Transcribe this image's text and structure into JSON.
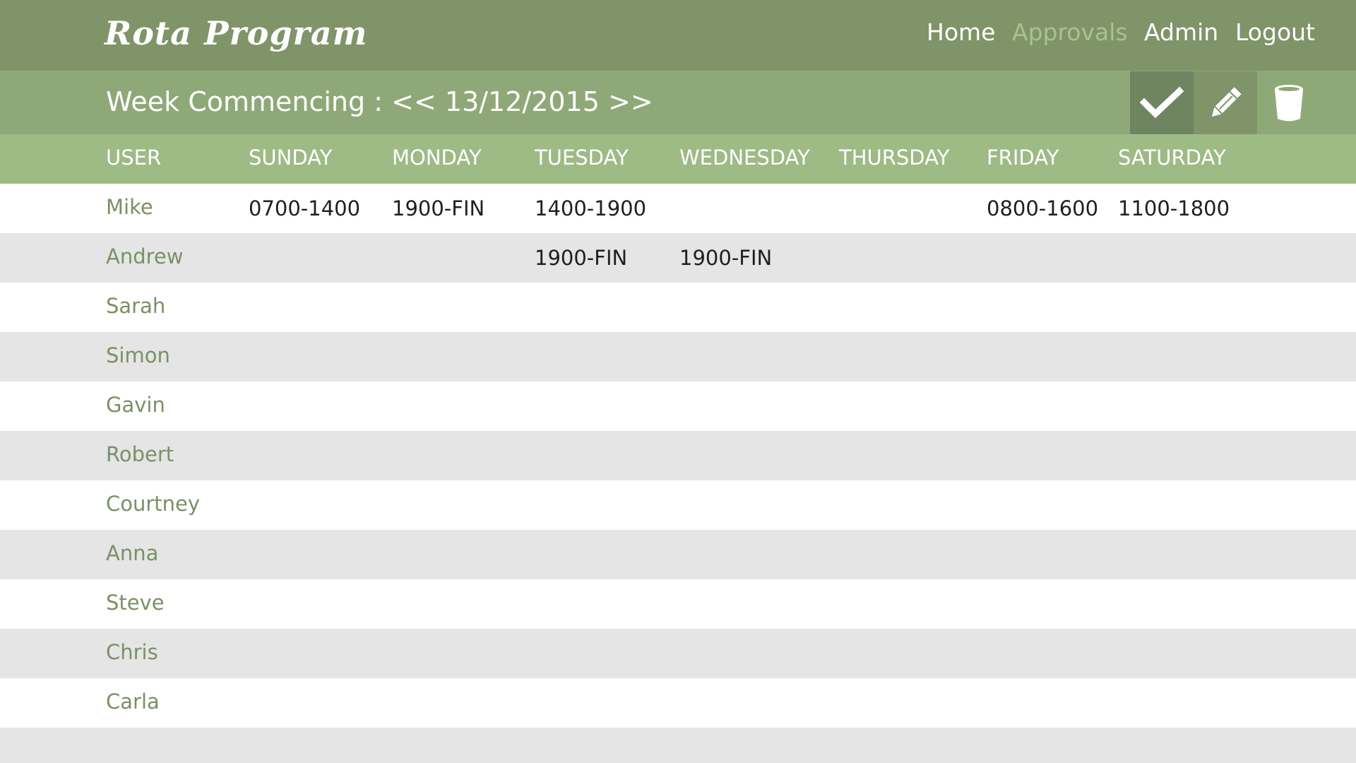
{
  "app": {
    "title": "Rota Program"
  },
  "nav": {
    "home": "Home",
    "approvals": "Approvals",
    "admin": "Admin",
    "logout": "Logout"
  },
  "week": {
    "label": "Week Commencing :",
    "prev": "<<",
    "date": "13/12/2015",
    "next": ">>"
  },
  "toolbar": {
    "approve_icon": "check-icon",
    "edit_icon": "pencil-icon",
    "delete_icon": "bin-icon"
  },
  "colors": {
    "topbar": "#7f9469",
    "weekbar": "#8fa878",
    "header": "#9eba85",
    "accent_text": "#7b9065",
    "active_nav": "#a9c38c"
  },
  "table": {
    "headers": [
      "USER",
      "SUNDAY",
      "MONDAY",
      "TUESDAY",
      "WEDNESDAY",
      "THURSDAY",
      "FRIDAY",
      "SATURDAY"
    ],
    "rows": [
      {
        "user": "Mike",
        "shifts": [
          "0700-1400",
          "1900-FIN",
          "1400-1900",
          "",
          "",
          "0800-1600",
          "1100-1800"
        ]
      },
      {
        "user": "Andrew",
        "shifts": [
          "",
          "",
          "1900-FIN",
          "1900-FIN",
          "",
          "",
          ""
        ]
      },
      {
        "user": "Sarah",
        "shifts": [
          "",
          "",
          "",
          "",
          "",
          "",
          ""
        ]
      },
      {
        "user": "Simon",
        "shifts": [
          "",
          "",
          "",
          "",
          "",
          "",
          ""
        ]
      },
      {
        "user": "Gavin",
        "shifts": [
          "",
          "",
          "",
          "",
          "",
          "",
          ""
        ]
      },
      {
        "user": "Robert",
        "shifts": [
          "",
          "",
          "",
          "",
          "",
          "",
          ""
        ]
      },
      {
        "user": "Courtney",
        "shifts": [
          "",
          "",
          "",
          "",
          "",
          "",
          ""
        ]
      },
      {
        "user": "Anna",
        "shifts": [
          "",
          "",
          "",
          "",
          "",
          "",
          ""
        ]
      },
      {
        "user": "Steve",
        "shifts": [
          "",
          "",
          "",
          "",
          "",
          "",
          ""
        ]
      },
      {
        "user": "Chris",
        "shifts": [
          "",
          "",
          "",
          "",
          "",
          "",
          ""
        ]
      },
      {
        "user": "Carla",
        "shifts": [
          "",
          "",
          "",
          "",
          "",
          "",
          ""
        ]
      }
    ]
  }
}
